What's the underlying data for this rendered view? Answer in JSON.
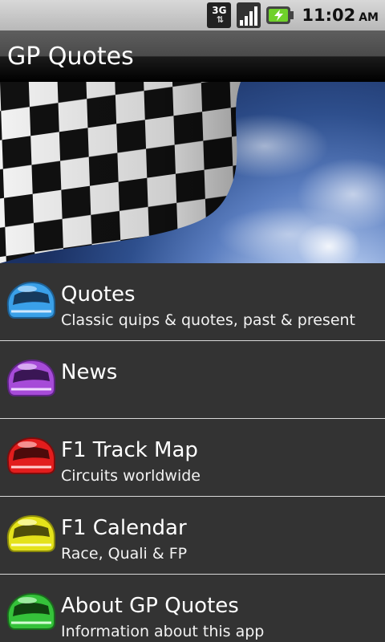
{
  "status_bar": {
    "network": "3G",
    "time": "11:02",
    "ampm": "AM"
  },
  "title_bar": {
    "title": "GP Quotes"
  },
  "menu": [
    {
      "title": "Quotes",
      "subtitle": "Classic quips & quotes, past & present",
      "helmet_color": "#3aa0e8"
    },
    {
      "title": "News",
      "subtitle": "",
      "helmet_color": "#a64bd8"
    },
    {
      "title": "F1 Track Map",
      "subtitle": "Circuits worldwide",
      "helmet_color": "#e21d1d"
    },
    {
      "title": "F1 Calendar",
      "subtitle": "Race, Quali & FP",
      "helmet_color": "#e4e21a"
    },
    {
      "title": "About GP Quotes",
      "subtitle": "Information about this app",
      "helmet_color": "#35c23a"
    }
  ],
  "icons": {
    "network": "3g-data-icon",
    "signal": "signal-strength-icon",
    "battery": "battery-charging-icon",
    "helmet": "racing-helmet-icon",
    "banner": "checkered-flag-image"
  }
}
